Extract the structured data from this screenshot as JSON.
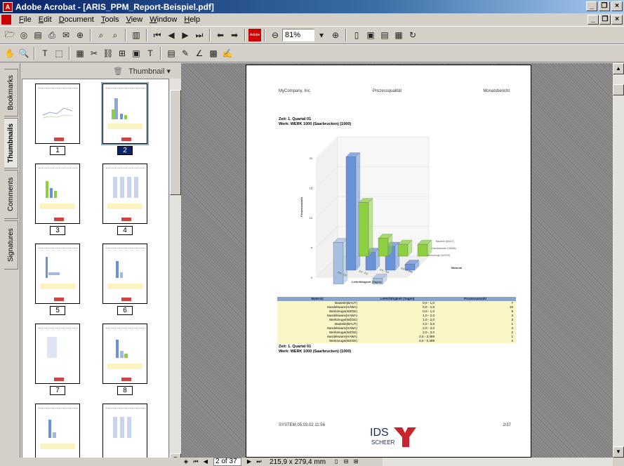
{
  "window": {
    "title": "Adobe Acrobat - [ARIS_PPM_Report-Beispiel.pdf]",
    "controls": [
      "_",
      "̲❐",
      "X"
    ],
    "mdi_controls": [
      "_",
      "❐",
      "X"
    ]
  },
  "menu": [
    "File",
    "Edit",
    "Document",
    "Tools",
    "View",
    "Window",
    "Help"
  ],
  "toolbar": {
    "zoom_value": "81%",
    "adobe_label": "Adobe"
  },
  "side_tabs": [
    "Bookmarks",
    "Thumbnails",
    "Comments",
    "Signatures"
  ],
  "thumbnail_panel": {
    "menu_label": "Thumbnail",
    "pages": [
      "1",
      "2",
      "3",
      "4",
      "5",
      "6",
      "7",
      "8"
    ],
    "selected_page": "2"
  },
  "document": {
    "header_left": "MyCompany, Inc.",
    "header_center": "Prozessqualität",
    "header_right": "Monatsbericht",
    "zeit_line": "Zeit: 1. Quartal 01",
    "werk_line": "Werk: WERK 1000 (Saarbrucken) (1000)",
    "zeit_line_2": "Zeit: 1. Quartal 01",
    "werk_line_2": "Werk: WERK 1000 (Saarbrucken) (1000)",
    "footer_left": "SYSTEM,05.03.02 11:56",
    "footer_right": "2/37",
    "logo_text_top": "IDS",
    "logo_text_bottom": "SCHEER"
  },
  "chart_data": {
    "type": "bar",
    "title": "",
    "xlabel": "Lieferfähigkeit (Tagen)",
    "ylabel": "Prozessanzahl",
    "zlabel": "Material",
    "categories": [
      "0,0 - 1,0",
      "1,0 - 2,0",
      "2,0 - 3,0",
      "3,0 - 3,499"
    ],
    "yticks": [
      "0",
      "5",
      "10",
      "15",
      "20"
    ],
    "ylim": [
      0,
      20
    ],
    "series": [
      {
        "name": "Bauteile (BAUT)",
        "values": [
          7,
          0,
          1,
          0
        ],
        "color": "#a7c0e0"
      },
      {
        "name": "Handelsware (HAWA)",
        "values": [
          19,
          3,
          4,
          1
        ],
        "color": "#6a92d8"
      },
      {
        "name": "Werkzeuge (WZGE)",
        "values": [
          9,
          3,
          2,
          2
        ],
        "color": "#8cd040"
      }
    ]
  },
  "table": {
    "headers": [
      "Material",
      "Lieferfähigkeit (Tagen)",
      "Prozessanzahl"
    ],
    "rows": [
      [
        "Bauteile(BAUT)",
        "0,0 - 1,0",
        "7"
      ],
      [
        "Handelsware(HAWA)",
        "0,0 - 1,0",
        "19"
      ],
      [
        "Werkzeuge(WZGE)",
        "0,0 - 1,0",
        "9"
      ],
      [
        "Handelsware(HAWA)",
        "1,0 - 2,0",
        "3"
      ],
      [
        "Werkzeuge(WZGE)",
        "1,0 - 2,0",
        "3"
      ],
      [
        "Bauteile(BAUT)",
        "2,0 - 3,0",
        "1"
      ],
      [
        "Handelsware(HAWA)",
        "2,0 - 3,0",
        "4"
      ],
      [
        "Werkzeuge(WZGE)",
        "2,0 - 3,0",
        "2"
      ],
      [
        "Handelsware(HAWA)",
        "3,0 - 3,499",
        "1"
      ],
      [
        "Werkzeuge(WZGE)",
        "3,0 - 3,499",
        "2"
      ]
    ]
  },
  "statusbar": {
    "page_indicator": "2 of 37",
    "page_size": "215,9 x 279,4 mm"
  }
}
